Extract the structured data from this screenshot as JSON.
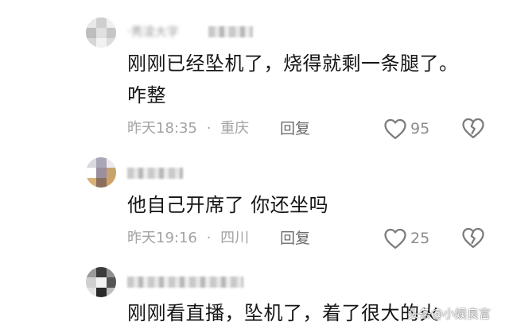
{
  "comments": [
    {
      "username": "·秀凌大字",
      "text_lines": [
        "刚刚已经坠机了，烧得就剩一条腿了。",
        "咋整"
      ],
      "time": "昨天18:35",
      "location": "重庆",
      "reply_label": "回复",
      "likes": "95"
    },
    {
      "username": "",
      "text_lines": [
        "他自己开席了  你还坐吗"
      ],
      "time": "昨天19:16",
      "location": "四川",
      "reply_label": "回复",
      "likes": "25"
    },
    {
      "username": "",
      "text_lines": [
        "刚刚看直播，坠机了，着了很大的火"
      ],
      "time": "",
      "location": "",
      "reply_label": "",
      "likes": ""
    }
  ],
  "separator": "·",
  "watermark": "头条@小娱良言",
  "icons": {
    "like": "heart-outline-icon",
    "dislike": "broken-heart-icon"
  },
  "colors": {
    "text": "#151515",
    "meta": "#a3a3a3",
    "icon": "#7a7a7a"
  }
}
